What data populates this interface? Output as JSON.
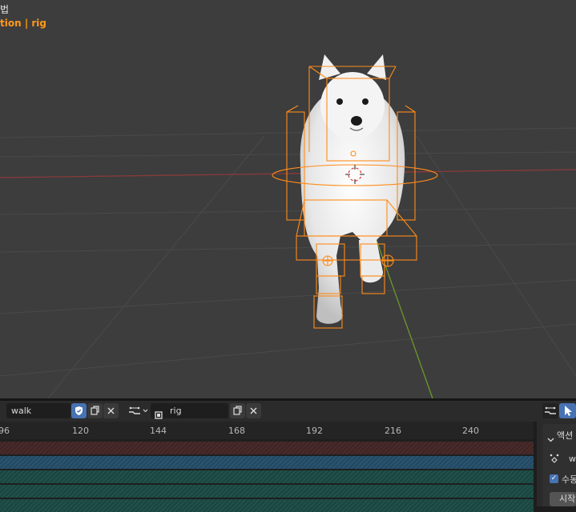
{
  "viewport": {
    "title": "법",
    "subtitle": "tion | rig"
  },
  "toolbar": {
    "action_name": "walk",
    "fake_user_icon": "shield-check-icon",
    "copy_icon": "duplicate-icon",
    "unlink_icon": "close-icon",
    "slot_icon": "action-slot-icon",
    "slot_name": "rig"
  },
  "ruler": {
    "ticks": [
      "96",
      "120",
      "144",
      "168",
      "192",
      "216",
      "240"
    ]
  },
  "sidebar": {
    "panel_label": "액션",
    "action_prefix": "w",
    "manual_label": "수동",
    "start_label": "시작"
  },
  "colors": {
    "accent": "#ff9a1a",
    "selection": "#4772b3",
    "viewport_bg": "#3d3d3d"
  }
}
